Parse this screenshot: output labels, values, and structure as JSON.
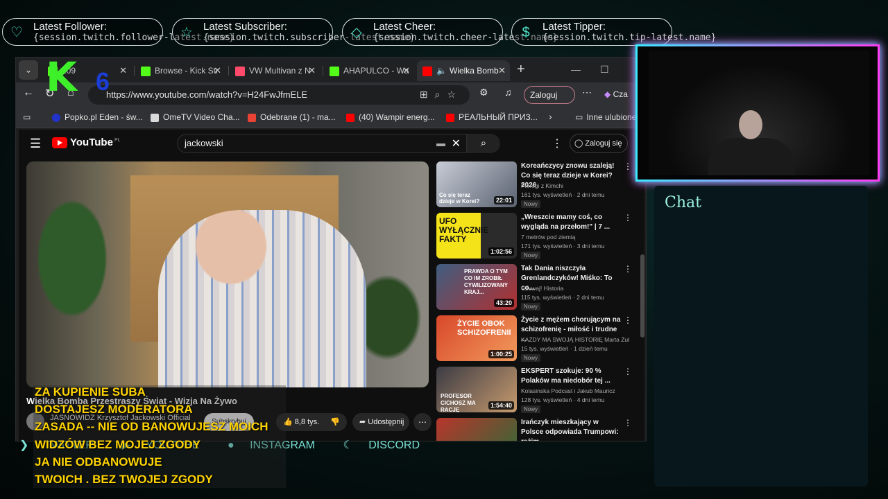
{
  "alerts": [
    {
      "label": "Latest Follower:",
      "value": "{session.twitch.follower-latest.name}",
      "icon": "heart-icon"
    },
    {
      "label": "Latest Subscriber:",
      "value": "{session.twitch.subscriber-latest.name}",
      "icon": "star-icon"
    },
    {
      "label": "Latest Cheer:",
      "value": "{session.twitch.cheer-latest.name}",
      "icon": "diamond-icon"
    },
    {
      "label": "Latest Tipper:",
      "value": "{session.twitch.tip-latest.name}",
      "icon": "dollar-icon"
    }
  ],
  "logo": {
    "letter": "K",
    "digit": "6"
  },
  "browser": {
    "tabs": [
      {
        "label": "209",
        "favicon_color": "#53fc18"
      },
      {
        "label": "Browse - Kick Str",
        "favicon_color": "#53fc18"
      },
      {
        "label": "VW Multivan z N",
        "favicon_color": "#ff4a6b"
      },
      {
        "label": "AHAPULCO - Wa",
        "favicon_color": "#53fc18"
      },
      {
        "label": "Wielka Bomb",
        "favicon_color": "#ff0000"
      }
    ],
    "url": "https://www.youtube.com/watch?v=H24FwJfmELE",
    "login_label": "Zaloguj",
    "copilot_label": "Cza",
    "bookmarks": [
      "Popko.pl Eden - św...",
      "OmeTV Video Cha...",
      "Odebrane (1) - ma...",
      "(40) Wampir energ...",
      "РЕАЛЬНЫЙ ПРИЗ...",
      "Inne ulubione"
    ]
  },
  "youtube": {
    "logo_text": "YouTube",
    "logo_region": "PL",
    "search_query": "jackowski",
    "login_label": "Zaloguj się",
    "video_title": "Wielka Bomba Przestraszy Świat - Wizja Na Żywo",
    "channel_name": "JASNOWIDZ Krzysztof Jackowski Official",
    "subscribe_label": "Subskrybuj",
    "likes": "8,8 tys.",
    "share_label": "Udostępnij",
    "recommendations": [
      {
        "title": "Koreańczycy znowu szaleją! Co się teraz dzieje w Korei? 2026",
        "channel": "Pierogi z Kimchi",
        "views": "161 tys. wyświetleń · 2 dni temu",
        "duration": "22:01",
        "badge": "Nowy",
        "thumb_text": "Co się teraz dzieje w Korei?",
        "thumb_colors": [
          "#c8ccd6",
          "#5a6270"
        ]
      },
      {
        "title": "„Wreszcie mamy coś, co wygląda na przełom!\" | 7 ...",
        "channel": "7 metrów pod ziemią",
        "views": "171 tys. wyświetleń · 3 dni temu",
        "duration": "1:02:56",
        "badge": "Nowy",
        "thumb_text": "UFO WYŁĄCZNIE FAKTY",
        "thumb_colors": [
          "#f5e31a",
          "#2b2b2b"
        ]
      },
      {
        "title": "Tak Dania niszczyła Grenlandczyków! Miśko: To co...",
        "channel": "Czuwaj! Historia",
        "views": "115 tys. wyświetleń · 2 dni temu",
        "duration": "43:20",
        "badge": "Nowy",
        "thumb_text": "PRAWDA O TYM CO IM ZROBIŁ CYWILIZOWANY KRAJ...",
        "thumb_colors": [
          "#3f5d80",
          "#b23030"
        ]
      },
      {
        "title": "Życie z mężem chorującym na schizofrenię - miłość i trudne ...",
        "channel": "KAŻDY MA SWOJĄ HISTORIĘ Marta Żuk",
        "views": "15 tys. wyświetleń · 1 dzień temu",
        "duration": "1:00:25",
        "badge": "Nowy",
        "thumb_text": "ŻYCIE OBOK SCHIZOFRENII",
        "thumb_colors": [
          "#d8482a",
          "#f29a5c"
        ]
      },
      {
        "title": "EKSPERT szokuje: 90 % Polaków ma niedobór tej ...",
        "channel": "Kolasinska Podcast i Jakub Mauricz",
        "views": "128 tys. wyświetleń · 4 dni temu",
        "duration": "1:54:40",
        "badge": "Nowy",
        "thumb_text": "PROFESOR CICHOSZ MA RACJĘ",
        "thumb_colors": [
          "#3b3b44",
          "#c79a6e"
        ]
      },
      {
        "title": "Irańczyk mieszkający w Polsce odpowiada Trumpowi: reżim ...",
        "channel": "",
        "views": "",
        "duration": "",
        "badge": "",
        "thumb_text": "",
        "thumb_colors": [
          "#b8352c",
          "#2e6b37"
        ]
      }
    ]
  },
  "chat": {
    "label": "Chat"
  },
  "socials": [
    "TWITTER",
    "YOUTUBE",
    "INSTAGRAM",
    "DISCORD"
  ],
  "overlay_lines": [
    "ZA KUPIENIE SUBA",
    "DOSTAJESZ MODERATORA",
    "ZASADA -- NIE OD BANOWUJESZ MOICH",
    "WIDZÓW BEZ MOJEJ ZGODY",
    "JA NIE ODBANOWUJE",
    "TWOICH . BEZ TWOJEJ ZGODY"
  ]
}
